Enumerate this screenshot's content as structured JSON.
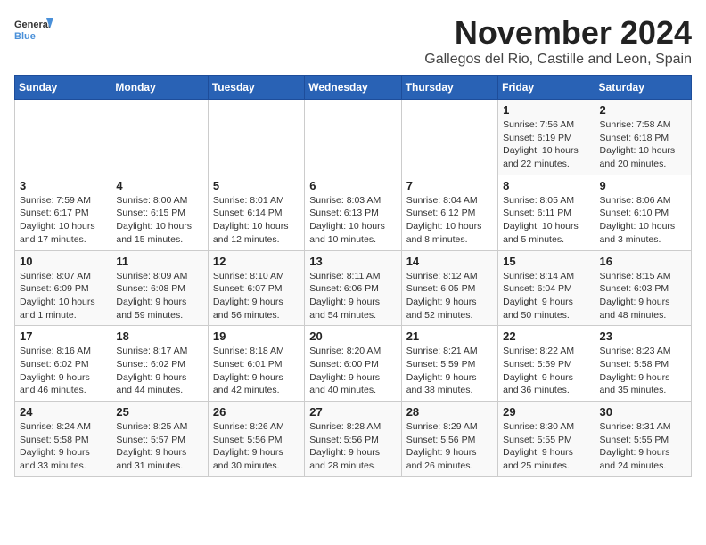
{
  "logo": {
    "general": "General",
    "blue": "Blue"
  },
  "header": {
    "month": "November 2024",
    "location": "Gallegos del Rio, Castille and Leon, Spain"
  },
  "weekdays": [
    "Sunday",
    "Monday",
    "Tuesday",
    "Wednesday",
    "Thursday",
    "Friday",
    "Saturday"
  ],
  "weeks": [
    [
      {
        "day": "",
        "info": ""
      },
      {
        "day": "",
        "info": ""
      },
      {
        "day": "",
        "info": ""
      },
      {
        "day": "",
        "info": ""
      },
      {
        "day": "",
        "info": ""
      },
      {
        "day": "1",
        "info": "Sunrise: 7:56 AM\nSunset: 6:19 PM\nDaylight: 10 hours and 22 minutes."
      },
      {
        "day": "2",
        "info": "Sunrise: 7:58 AM\nSunset: 6:18 PM\nDaylight: 10 hours and 20 minutes."
      }
    ],
    [
      {
        "day": "3",
        "info": "Sunrise: 7:59 AM\nSunset: 6:17 PM\nDaylight: 10 hours and 17 minutes."
      },
      {
        "day": "4",
        "info": "Sunrise: 8:00 AM\nSunset: 6:15 PM\nDaylight: 10 hours and 15 minutes."
      },
      {
        "day": "5",
        "info": "Sunrise: 8:01 AM\nSunset: 6:14 PM\nDaylight: 10 hours and 12 minutes."
      },
      {
        "day": "6",
        "info": "Sunrise: 8:03 AM\nSunset: 6:13 PM\nDaylight: 10 hours and 10 minutes."
      },
      {
        "day": "7",
        "info": "Sunrise: 8:04 AM\nSunset: 6:12 PM\nDaylight: 10 hours and 8 minutes."
      },
      {
        "day": "8",
        "info": "Sunrise: 8:05 AM\nSunset: 6:11 PM\nDaylight: 10 hours and 5 minutes."
      },
      {
        "day": "9",
        "info": "Sunrise: 8:06 AM\nSunset: 6:10 PM\nDaylight: 10 hours and 3 minutes."
      }
    ],
    [
      {
        "day": "10",
        "info": "Sunrise: 8:07 AM\nSunset: 6:09 PM\nDaylight: 10 hours and 1 minute."
      },
      {
        "day": "11",
        "info": "Sunrise: 8:09 AM\nSunset: 6:08 PM\nDaylight: 9 hours and 59 minutes."
      },
      {
        "day": "12",
        "info": "Sunrise: 8:10 AM\nSunset: 6:07 PM\nDaylight: 9 hours and 56 minutes."
      },
      {
        "day": "13",
        "info": "Sunrise: 8:11 AM\nSunset: 6:06 PM\nDaylight: 9 hours and 54 minutes."
      },
      {
        "day": "14",
        "info": "Sunrise: 8:12 AM\nSunset: 6:05 PM\nDaylight: 9 hours and 52 minutes."
      },
      {
        "day": "15",
        "info": "Sunrise: 8:14 AM\nSunset: 6:04 PM\nDaylight: 9 hours and 50 minutes."
      },
      {
        "day": "16",
        "info": "Sunrise: 8:15 AM\nSunset: 6:03 PM\nDaylight: 9 hours and 48 minutes."
      }
    ],
    [
      {
        "day": "17",
        "info": "Sunrise: 8:16 AM\nSunset: 6:02 PM\nDaylight: 9 hours and 46 minutes."
      },
      {
        "day": "18",
        "info": "Sunrise: 8:17 AM\nSunset: 6:02 PM\nDaylight: 9 hours and 44 minutes."
      },
      {
        "day": "19",
        "info": "Sunrise: 8:18 AM\nSunset: 6:01 PM\nDaylight: 9 hours and 42 minutes."
      },
      {
        "day": "20",
        "info": "Sunrise: 8:20 AM\nSunset: 6:00 PM\nDaylight: 9 hours and 40 minutes."
      },
      {
        "day": "21",
        "info": "Sunrise: 8:21 AM\nSunset: 5:59 PM\nDaylight: 9 hours and 38 minutes."
      },
      {
        "day": "22",
        "info": "Sunrise: 8:22 AM\nSunset: 5:59 PM\nDaylight: 9 hours and 36 minutes."
      },
      {
        "day": "23",
        "info": "Sunrise: 8:23 AM\nSunset: 5:58 PM\nDaylight: 9 hours and 35 minutes."
      }
    ],
    [
      {
        "day": "24",
        "info": "Sunrise: 8:24 AM\nSunset: 5:58 PM\nDaylight: 9 hours and 33 minutes."
      },
      {
        "day": "25",
        "info": "Sunrise: 8:25 AM\nSunset: 5:57 PM\nDaylight: 9 hours and 31 minutes."
      },
      {
        "day": "26",
        "info": "Sunrise: 8:26 AM\nSunset: 5:56 PM\nDaylight: 9 hours and 30 minutes."
      },
      {
        "day": "27",
        "info": "Sunrise: 8:28 AM\nSunset: 5:56 PM\nDaylight: 9 hours and 28 minutes."
      },
      {
        "day": "28",
        "info": "Sunrise: 8:29 AM\nSunset: 5:56 PM\nDaylight: 9 hours and 26 minutes."
      },
      {
        "day": "29",
        "info": "Sunrise: 8:30 AM\nSunset: 5:55 PM\nDaylight: 9 hours and 25 minutes."
      },
      {
        "day": "30",
        "info": "Sunrise: 8:31 AM\nSunset: 5:55 PM\nDaylight: 9 hours and 24 minutes."
      }
    ]
  ]
}
